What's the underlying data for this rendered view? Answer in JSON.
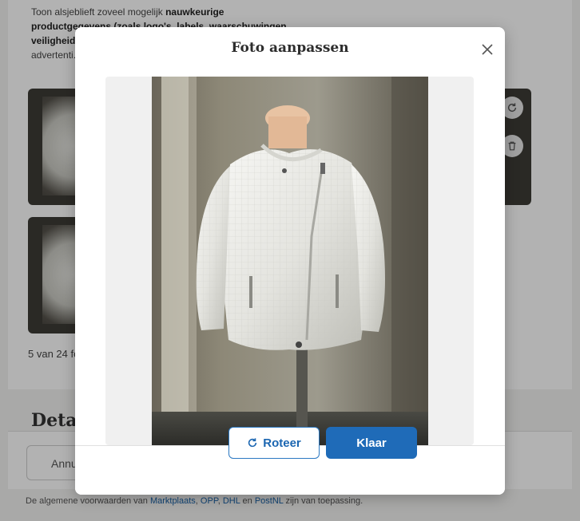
{
  "intro": {
    "text_start": "Toon alsjeblieft zoveel mogelijk ",
    "bold": "nauwkeurige productgegevens (zoals logo's, labels, waarschuwingen, veiligheid",
    "text_end": "advertenti... vergroten"
  },
  "photos": {
    "count_label": "5 van 24 fo"
  },
  "details": {
    "heading": "Detail"
  },
  "footer": {
    "cancel_label": "Annu",
    "legal": {
      "prefix": "De algemene voorwaarden van ",
      "link1": "Marktplaats",
      "sep1": ", ",
      "link2": "OPP",
      "sep2": ", ",
      "link3": "DHL",
      "sep3": " en ",
      "link4": "PostNL",
      "suffix": " zijn van toepassing."
    }
  },
  "modal": {
    "title": "Foto aanpassen",
    "rotate_label": "Roteer",
    "done_label": "Klaar",
    "icons": {
      "close": "close-icon",
      "rotate": "rotate-icon"
    }
  },
  "colors": {
    "primary": "#1f6bb8",
    "link": "#1a63a8"
  }
}
